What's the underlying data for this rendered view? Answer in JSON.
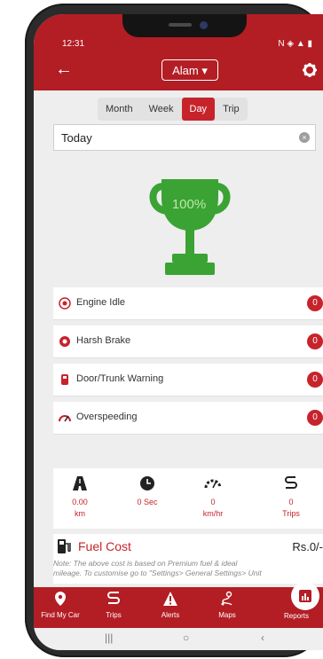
{
  "status": {
    "time": "12:31",
    "icons": "N ◈ ▲ ▮"
  },
  "appbar": {
    "vehicle": "Alam",
    "dropdown_glyph": "▾"
  },
  "tabs": [
    {
      "label": "Month"
    },
    {
      "label": "Week"
    },
    {
      "label": "Day",
      "active": true
    },
    {
      "label": "Trip"
    }
  ],
  "date_filter": {
    "value": "Today"
  },
  "score": {
    "percent_text": "100%"
  },
  "events": [
    {
      "label": "Engine Idle",
      "count": "0"
    },
    {
      "label": "Harsh Brake",
      "count": "0"
    },
    {
      "label": "Door/Trunk Warning",
      "count": "0"
    },
    {
      "label": "Overspeeding",
      "count": "0"
    }
  ],
  "stats": [
    {
      "value": "0.00",
      "unit": "km"
    },
    {
      "value": "0 Sec",
      "unit": ""
    },
    {
      "value": "0",
      "unit": "km/hr"
    },
    {
      "value": "0",
      "unit": "Trips"
    }
  ],
  "fuel": {
    "title": "Fuel Cost",
    "amount": "Rs.0/-",
    "note_line1": "Note: The above cost is based on Premium fuel & ideal",
    "note_line2": "mileage. To customise go to \"Settings> General Settings> Unit"
  },
  "bottom_nav": [
    {
      "label": "Find My Car"
    },
    {
      "label": "Trips"
    },
    {
      "label": "Alerts"
    },
    {
      "label": "Maps"
    },
    {
      "label": "Reports"
    }
  ],
  "system_nav": {
    "recents": "|||",
    "home": "○",
    "back": "‹"
  },
  "colors": {
    "primary": "#b31d24",
    "accent": "#c7232b",
    "trophy": "#3aa334"
  }
}
